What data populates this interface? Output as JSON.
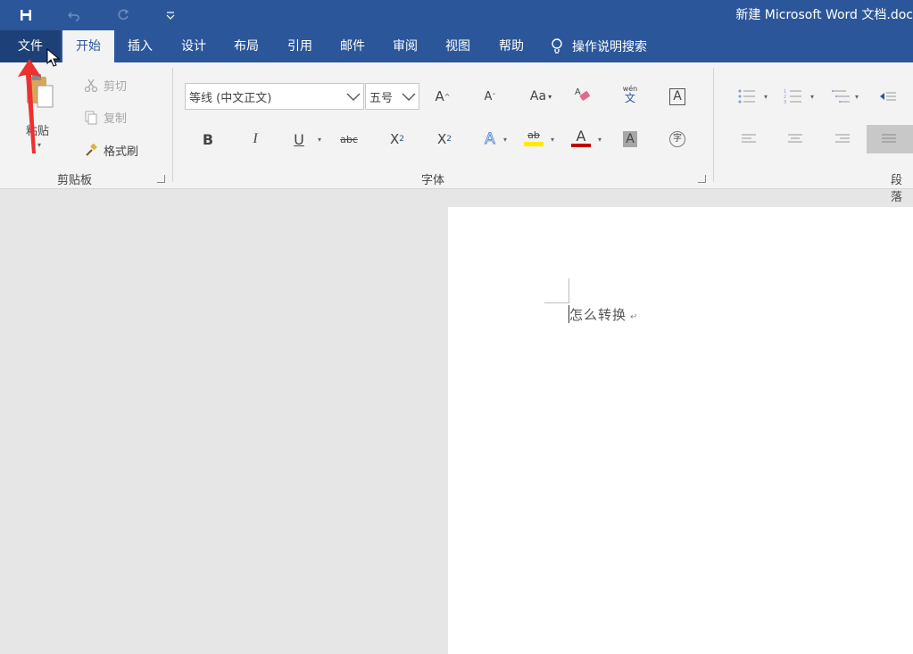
{
  "titlebar": {
    "save_icon": "save-icon",
    "undo_icon": "undo-icon",
    "redo_icon": "redo-icon",
    "customize_icon": "customize-quick-access-icon",
    "doc_title": "新建 Microsoft Word 文档.doc"
  },
  "tabs": {
    "file": "文件",
    "home": "开始",
    "insert": "插入",
    "design": "设计",
    "layout": "布局",
    "references": "引用",
    "mailings": "邮件",
    "review": "审阅",
    "view": "视图",
    "help": "帮助",
    "search": "操作说明搜索"
  },
  "clipboard": {
    "paste": "粘贴",
    "cut": "剪切",
    "copy": "复制",
    "format_painter": "格式刷",
    "group_label": "剪贴板"
  },
  "font": {
    "font_name": "等线 (中文正文)",
    "font_size": "五号",
    "group_label": "字体",
    "bold": "B",
    "italic": "I",
    "underline": "U",
    "strikethrough": "abc",
    "subscript": "X",
    "subscript_mark": "2",
    "superscript": "X",
    "superscript_mark": "2",
    "grow": "A",
    "shrink": "A",
    "change_case": "Aa",
    "phonetic_top": "wén",
    "phonetic_bottom": "文",
    "border_char": "A",
    "text_effect": "A",
    "highlight": "ab",
    "font_color": "A",
    "shading_char": "A",
    "enclose_char": "字",
    "colors": {
      "highlight": "#ffeb00",
      "font_color": "#c00000",
      "accent": "#2b579a"
    }
  },
  "paragraph": {
    "group_label": "段落"
  },
  "document": {
    "text": "怎么转换"
  }
}
